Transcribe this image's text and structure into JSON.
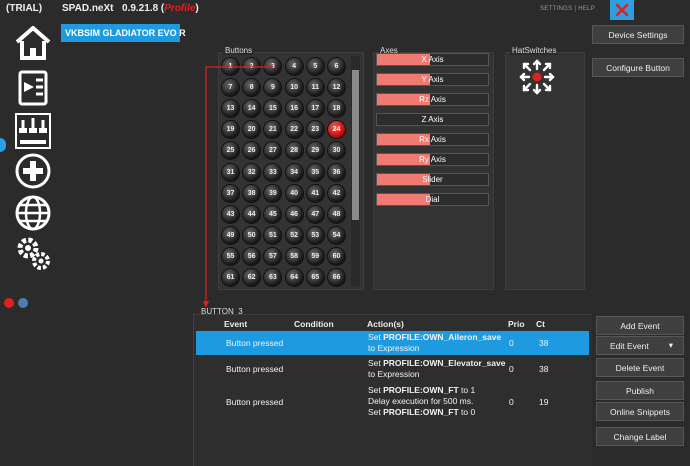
{
  "titlebar": {
    "trial": "(TRIAL)",
    "app": "SPAD.neXt",
    "version": "0.9.21.8 (",
    "profile": "Profile",
    "version_end": ")",
    "links": "SETTINGS  |  HELP"
  },
  "device_name": "VKBSIM GLADIATOR EVO R",
  "panels": {
    "buttons_title": "Buttons",
    "axes_title": "Axes",
    "hats_title": "HatSwitches"
  },
  "buttons": [
    "1",
    "2",
    "3",
    "4",
    "5",
    "6",
    "7",
    "8",
    "9",
    "10",
    "11",
    "12",
    "13",
    "14",
    "15",
    "16",
    "17",
    "18",
    "19",
    "20",
    "21",
    "22",
    "23",
    "24",
    "25",
    "26",
    "27",
    "28",
    "29",
    "30",
    "31",
    "32",
    "33",
    "34",
    "35",
    "36",
    "37",
    "38",
    "39",
    "40",
    "41",
    "42",
    "43",
    "44",
    "45",
    "46",
    "47",
    "48",
    "49",
    "50",
    "51",
    "52",
    "53",
    "54",
    "55",
    "56",
    "57",
    "58",
    "59",
    "60",
    "61",
    "62",
    "63",
    "64",
    "65",
    "66"
  ],
  "active_button": "24",
  "axes": [
    {
      "label": "X Axis",
      "level": 0.48
    },
    {
      "label": "Y Axis",
      "level": 0.48
    },
    {
      "label": "Rz Axis",
      "level": 0.48
    },
    {
      "label": "Z Axis",
      "level": 0.0
    },
    {
      "label": "Rx Axis",
      "level": 0.48
    },
    {
      "label": "Ry Axis",
      "level": 0.48
    },
    {
      "label": "Slider",
      "level": 0.48
    },
    {
      "label": "Dial",
      "level": 0.48
    }
  ],
  "right_buttons": {
    "device_settings": "Device Settings",
    "configure_button": "Configure Button"
  },
  "events_panel": {
    "title": "BUTTON_3",
    "headers": {
      "event": "Event",
      "condition": "Condition",
      "actions": "Action(s)",
      "prio": "Prio",
      "ct": "Ct"
    },
    "rows": [
      {
        "event": "Button pressed",
        "l1a": "Set ",
        "l1b": "PROFILE:OWN_Aileron_save",
        "l2": "to Expression",
        "l3": "",
        "l4a": "",
        "l4b": "",
        "l4c": "",
        "prio": "0",
        "ct": "38"
      },
      {
        "event": "Button pressed",
        "l1a": "Set ",
        "l1b": "PROFILE:OWN_Elevator_save",
        "l2": "to Expression",
        "l3": "",
        "l4a": "",
        "l4b": "",
        "l4c": "",
        "prio": "0",
        "ct": "38"
      },
      {
        "event": "Button pressed",
        "l1a": "Set ",
        "l1b": "PROFILE:OWN_FT",
        "l1c": " to 1",
        "l2": "Delay execution for 500 ms.",
        "l4a": "Set ",
        "l4b": "PROFILE:OWN_FT",
        "l4c": " to 0",
        "prio": "0",
        "ct": "19"
      }
    ]
  },
  "event_buttons": {
    "add": "Add Event",
    "edit": "Edit Event",
    "edit_arrow": "▾",
    "delete": "Delete Event",
    "publish": "Publish",
    "snippets": "Online Snippets",
    "label": "Change Label"
  },
  "colors": {
    "accent": "#1e9be0",
    "active_button": "#e02020",
    "axis_fill": "#f07a72"
  }
}
